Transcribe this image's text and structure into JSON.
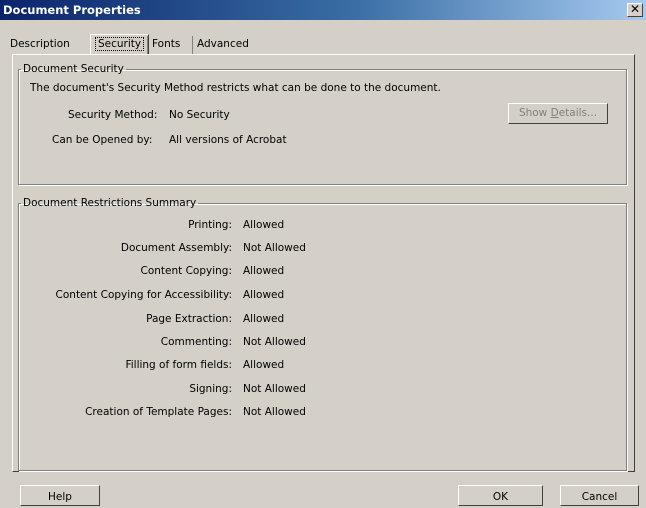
{
  "window": {
    "title": "Document Properties"
  },
  "tabs": [
    {
      "label": "Description"
    },
    {
      "label": "Security"
    },
    {
      "label": "Fonts"
    },
    {
      "label": "Advanced"
    }
  ],
  "security_group": {
    "legend": "Document Security",
    "description": "The document's Security Method restricts what can be done to the document.",
    "method_label": "Security Method:",
    "method_value": "No Security",
    "opened_label": "Can be Opened by:",
    "opened_value": "All versions of Acrobat",
    "details_button_pre": "Show ",
    "details_button_accel": "D",
    "details_button_post": "etails..."
  },
  "restrictions": {
    "legend": "Document Restrictions Summary",
    "rows": [
      {
        "label": "Printing:",
        "value": "Allowed"
      },
      {
        "label": "Document Assembly:",
        "value": "Not Allowed"
      },
      {
        "label": "Content Copying:",
        "value": "Allowed"
      },
      {
        "label": "Content Copying for Accessibility:",
        "value": "Allowed"
      },
      {
        "label": "Page Extraction:",
        "value": "Allowed"
      },
      {
        "label": "Commenting:",
        "value": "Not Allowed"
      },
      {
        "label": "Filling of form fields:",
        "value": "Allowed"
      },
      {
        "label": "Signing:",
        "value": "Not Allowed"
      },
      {
        "label": "Creation of Template Pages:",
        "value": "Not Allowed"
      }
    ]
  },
  "buttons": {
    "help": "Help",
    "ok": "OK",
    "cancel": "Cancel"
  },
  "icons": {
    "close": "close-icon"
  }
}
